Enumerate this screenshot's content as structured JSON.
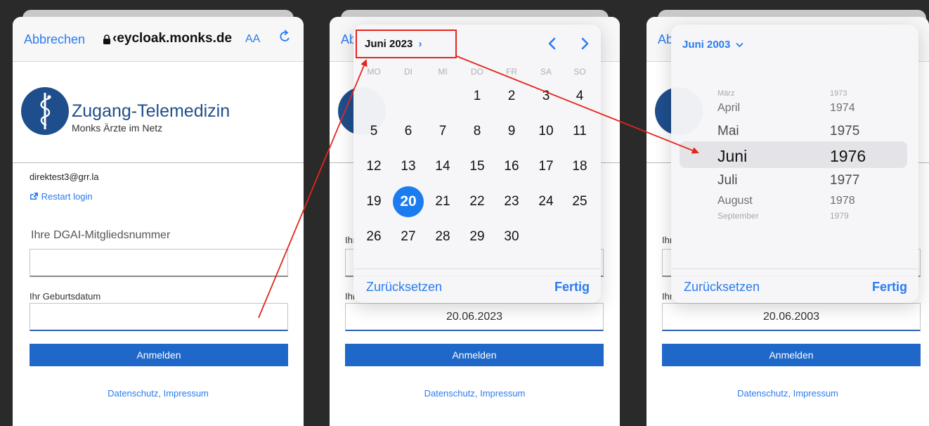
{
  "browser": {
    "cancel_label": "Abbrechen",
    "host": "‹eycloak.monks.de",
    "aa_label": "AA"
  },
  "brand": {
    "title": "Zugang-Telemedizin",
    "subtitle": "Monks Ärzte im Netz"
  },
  "login": {
    "email": "direktest3@grr.la",
    "restart_label": "Restart login",
    "member_label": "Ihre DGAI-Mitgliedsnummer",
    "birthdate_label": "Ihr Geburtsdatum",
    "submit_label": "Anmelden",
    "footer_datenschutz": "Datenschutz",
    "footer_sep": ", ",
    "footer_impressum": "Impressum"
  },
  "panel2": {
    "month_label": "Juni 2023",
    "weekdays": [
      "MO",
      "DI",
      "MI",
      "DO",
      "FR",
      "SA",
      "SO"
    ],
    "selected_day": "20",
    "reset_label": "Zurücksetzen",
    "done_label": "Fertig",
    "date_value": "20.06.2023",
    "peek_text_left": "Ab",
    "peek_member": "Ihr",
    "peek_birth": "Ihr"
  },
  "panel3": {
    "month_label": "Juni 2003",
    "months": [
      "März",
      "April",
      "Mai",
      "Juni",
      "Juli",
      "August",
      "September"
    ],
    "years": [
      "1973",
      "1974",
      "1975",
      "1976",
      "1977",
      "1978",
      "1979"
    ],
    "reset_label": "Zurücksetzen",
    "done_label": "Fertig",
    "date_value": "20.06.2003",
    "peek_text_left": "Ab",
    "peek_member": "Ihr",
    "peek_birth": "Ihr"
  },
  "colors": {
    "accent": "#2a7cf0",
    "brand": "#1f4e8c",
    "button": "#1f67c8",
    "annotation": "#e3261d"
  }
}
